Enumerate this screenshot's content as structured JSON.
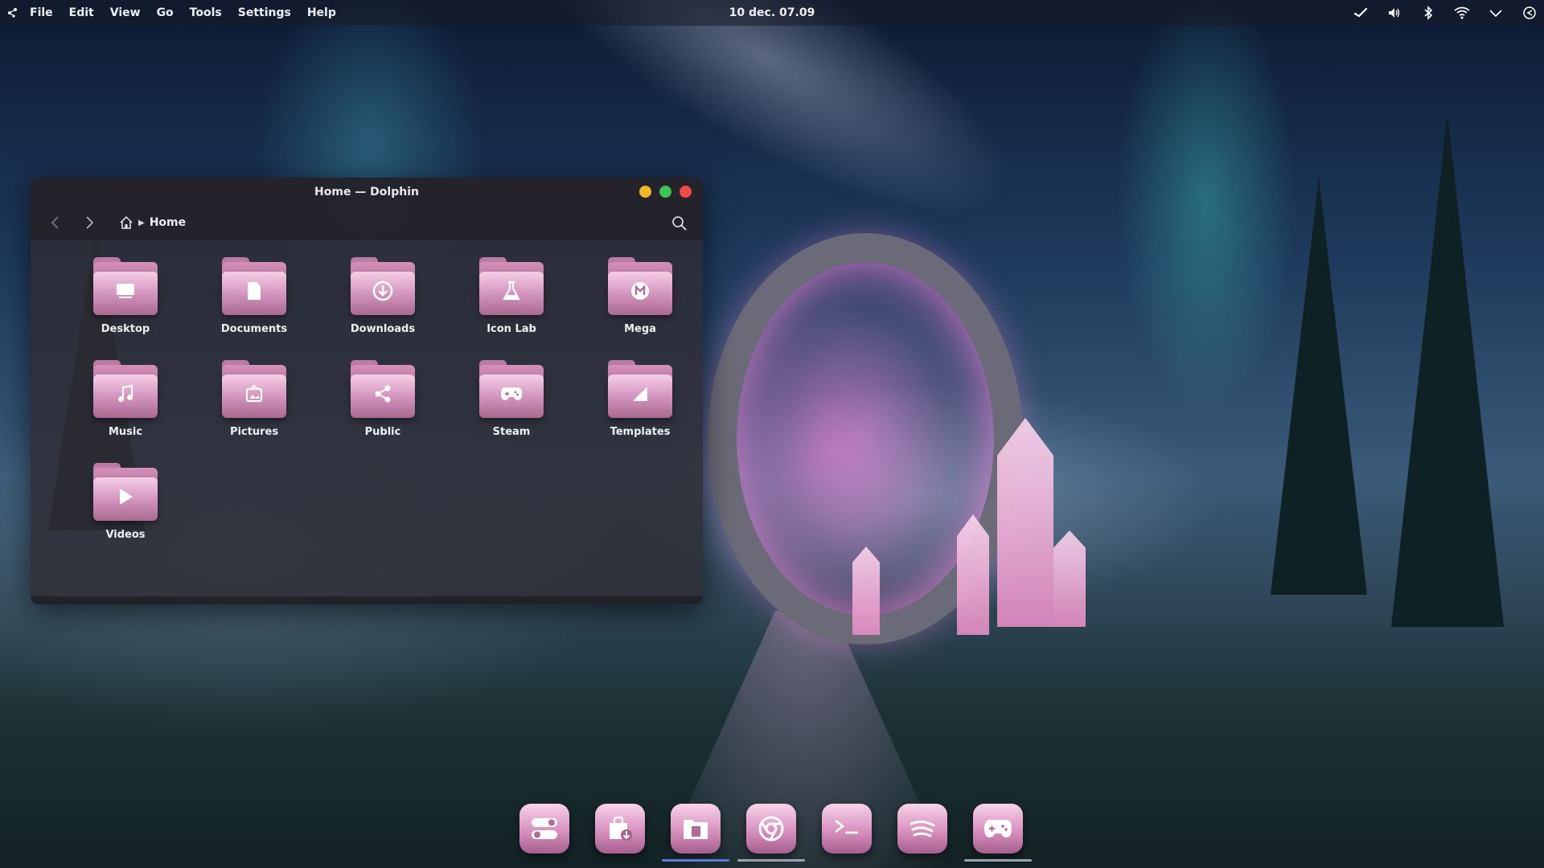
{
  "menubar": {
    "items": [
      "File",
      "Edit",
      "View",
      "Go",
      "Tools",
      "Settings",
      "Help"
    ]
  },
  "clock": "10 dec. 07.09",
  "tray": {
    "icons": [
      "steam-tray-icon",
      "volume-icon",
      "bluetooth-icon",
      "wifi-icon",
      "chevron-down-icon",
      "power-icon"
    ]
  },
  "window": {
    "title": "Home — Dolphin",
    "breadcrumb": "Home",
    "folders": [
      {
        "label": "Desktop",
        "icon": "desktop-icon"
      },
      {
        "label": "Documents",
        "icon": "document-icon"
      },
      {
        "label": "Downloads",
        "icon": "download-icon"
      },
      {
        "label": "Icon Lab",
        "icon": "flask-icon"
      },
      {
        "label": "Mega",
        "icon": "mega-icon"
      },
      {
        "label": "Music",
        "icon": "music-note-icon"
      },
      {
        "label": "Pictures",
        "icon": "picture-icon"
      },
      {
        "label": "Public",
        "icon": "share-icon"
      },
      {
        "label": "Steam",
        "icon": "gamepad-icon"
      },
      {
        "label": "Templates",
        "icon": "template-icon"
      },
      {
        "label": "Videos",
        "icon": "play-icon"
      }
    ]
  },
  "dock": {
    "items": [
      {
        "name": "settings-toggles",
        "icon": "toggle-switches-icon",
        "state": "none"
      },
      {
        "name": "software-store",
        "icon": "bag-download-icon",
        "state": "none"
      },
      {
        "name": "file-manager",
        "icon": "folder-files-icon",
        "state": "active"
      },
      {
        "name": "web-browser",
        "icon": "browser-icon",
        "state": "running"
      },
      {
        "name": "terminal",
        "icon": "terminal-icon",
        "state": "none"
      },
      {
        "name": "music-streaming",
        "icon": "spotify-icon",
        "state": "none"
      },
      {
        "name": "game-launcher",
        "icon": "gamepad-icon",
        "state": "running"
      }
    ]
  },
  "colors": {
    "folder_accent": "#d89bc4",
    "active_indicator": "#5a7cd8",
    "close": "#f04848",
    "minimize": "#f2b822",
    "maximize": "#3cc552"
  }
}
